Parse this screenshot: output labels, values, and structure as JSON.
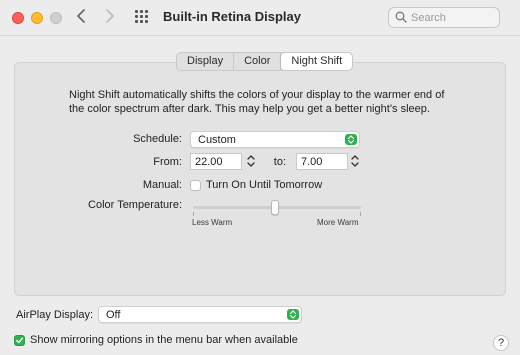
{
  "window": {
    "title": "Built-in Retina Display",
    "search": {
      "placeholder": "Search",
      "value": ""
    }
  },
  "tabs": [
    {
      "label": "Display",
      "active": false
    },
    {
      "label": "Color",
      "active": false
    },
    {
      "label": "Night Shift",
      "active": true
    }
  ],
  "night_shift": {
    "description": "Night Shift automatically shifts the colors of your display to the warmer end of the color spectrum after dark. This may help you get a better night’s sleep.",
    "schedule_label": "Schedule:",
    "schedule_value": "Custom",
    "from_label": "From:",
    "from_value": "22.00",
    "to_label": "to:",
    "to_value": "7.00",
    "manual_label": "Manual:",
    "manual_checkbox_label": "Turn On Until Tomorrow",
    "manual_checked": false,
    "color_temperature_label": "Color Temperature:",
    "slider_min_label": "Less Warm",
    "slider_max_label": "More Warm",
    "slider_value": 0.5
  },
  "bottom": {
    "airplay_label": "AirPlay Display:",
    "airplay_value": "Off",
    "mirroring_label": "Show mirroring options in the menu bar when available",
    "mirroring_checked": true,
    "help_label": "?"
  },
  "colors": {
    "accent_green": "#2fb150",
    "close": "#fe5f57",
    "minimize": "#febc2e",
    "zoom_inactive": "#cfcfcf"
  }
}
